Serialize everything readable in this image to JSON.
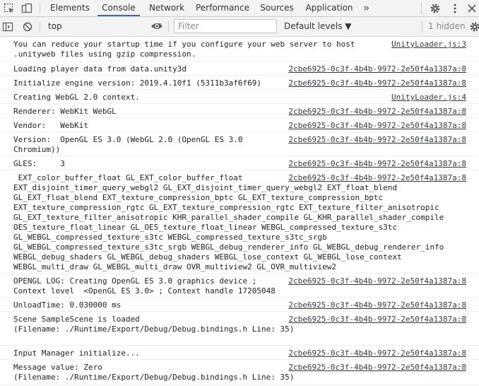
{
  "tabs": {
    "elements": "Elements",
    "console": "Console",
    "network": "Network",
    "performance": "Performance",
    "sources": "Sources",
    "application": "Application",
    "more": "»"
  },
  "toolbar": {
    "context": "top",
    "filter_placeholder": "Filter",
    "levels": "Default levels ▼",
    "hidden": "1 hidden"
  },
  "messages": [
    {
      "text": "You can reduce your startup time if you configure your web server to host\n.unityweb files using gzip compression.",
      "source": "UnityLoader.js:3"
    },
    {
      "text": "Loading player data from data.unity3d",
      "source": "2cbe6925-0c3f-4b4b-9972-2e50f4a1387a:8"
    },
    {
      "text": "Initialize engine version: 2019.4.10f1 (5311b3af6f69)",
      "source": "2cbe6925-0c3f-4b4b-9972-2e50f4a1387a:8"
    },
    {
      "text": "Creating WebGL 2.0 context.",
      "source": "UnityLoader.js:4"
    },
    {
      "text": "Renderer: WebKit WebGL",
      "source": "2cbe6925-0c3f-4b4b-9972-2e50f4a1387a:8"
    },
    {
      "text": "Vendor:   WebKit",
      "source": "2cbe6925-0c3f-4b4b-9972-2e50f4a1387a:8"
    },
    {
      "text": "Version:  OpenGL ES 3.0 (WebGL 2.0 (OpenGL ES 3.0\nChromium))",
      "source": "2cbe6925-0c3f-4b4b-9972-2e50f4a1387a:8"
    },
    {
      "text": "GLES:     3",
      "source": "2cbe6925-0c3f-4b4b-9972-2e50f4a1387a:8"
    },
    {
      "text": " EXT_color_buffer_float GL_EXT_color_buffer_float\nEXT_disjoint_timer_query_webgl2 GL_EXT_disjoint_timer_query_webgl2 EXT_float_blend\nGL_EXT_float_blend EXT_texture_compression_bptc GL_EXT_texture_compression_bptc\nEXT_texture_compression_rgtc GL_EXT_texture_compression_rgtc EXT_texture_filter_anisotropic\nGL_EXT_texture_filter_anisotropic KHR_parallel_shader_compile GL_KHR_parallel_shader_compile\nOES_texture_float_linear GL_OES_texture_float_linear WEBGL_compressed_texture_s3tc\nGL_WEBGL_compressed_texture_s3tc WEBGL_compressed_texture_s3tc_srgb\nGL_WEBGL_compressed_texture_s3tc_srgb WEBGL_debug_renderer_info GL_WEBGL_debug_renderer_info\nWEBGL_debug_shaders GL_WEBGL_debug_shaders WEBGL_lose_context GL_WEBGL_lose_context\nWEBGL_multi_draw GL_WEBGL_multi_draw OVR_multiview2 GL_OVR_multiview2",
      "source": "2cbe6925-0c3f-4b4b-9972-2e50f4a1387a:8"
    },
    {
      "text": "OPENGL LOG: Creating OpenGL ES 3.0 graphics device ;\nContext level  <OpenGL ES 3.0> ; Context handle 17205048",
      "source": "2cbe6925-0c3f-4b4b-9972-2e50f4a1387a:8"
    },
    {
      "text": "UnloadTime: 0.030000 ms",
      "source": "2cbe6925-0c3f-4b4b-9972-2e50f4a1387a:8"
    },
    {
      "text": "Scene SampleScene is loaded\n(Filename: ./Runtime/Export/Debug/Debug.bindings.h Line: 35)",
      "source": "2cbe6925-0c3f-4b4b-9972-2e50f4a1387a:8"
    },
    {
      "text": "Input Manager initialize...",
      "source": "2cbe6925-0c3f-4b4b-9972-2e50f4a1387a:8"
    },
    {
      "text": "Message value: Zero\n(Filename: ./Runtime/Export/Debug/Debug.bindings.h Line: 35)",
      "source": "2cbe6925-0c3f-4b4b-9972-2e50f4a1387a:8"
    }
  ]
}
